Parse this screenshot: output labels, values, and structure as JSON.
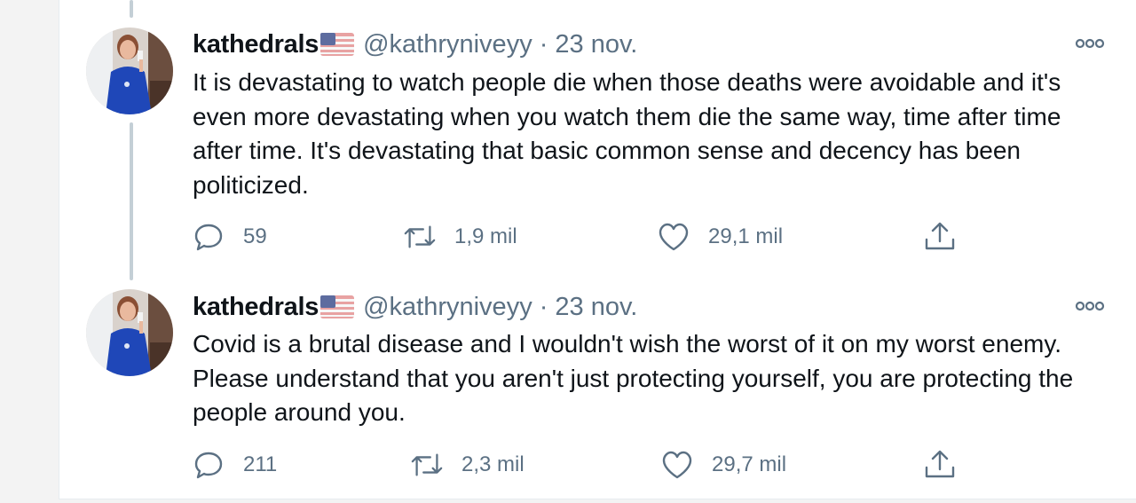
{
  "thread": {
    "tweets": [
      {
        "display_name": "kathedrals",
        "flag": "us-flag",
        "handle": "@kathryniveyy",
        "separator": "·",
        "date": "23 nov.",
        "text": "It is devastating to watch people die when those deaths were avoidable and it's even more devastating when you watch them die the same way, time after time after time. It's devastating that basic common sense and decency has been politicized.",
        "replies": "59",
        "retweets": "1,9 mil",
        "likes": "29,1 mil"
      },
      {
        "display_name": "kathedrals",
        "flag": "us-flag",
        "handle": "@kathryniveyy",
        "separator": "·",
        "date": "23 nov.",
        "text": "Covid is a brutal disease and I wouldn't wish the worst of it on my worst enemy. Please understand that you aren't just protecting yourself, you are protecting the people around you.",
        "replies": "211",
        "retweets": "2,3 mil",
        "likes": "29,7 mil"
      }
    ]
  },
  "colors": {
    "text": "#0f1419",
    "secondary": "#5b7083",
    "thread_line": "#c4cfd6",
    "dress_blue": "#1f47b8"
  },
  "icons": [
    "more-icon",
    "reply-icon",
    "retweet-icon",
    "like-icon",
    "share-icon"
  ]
}
